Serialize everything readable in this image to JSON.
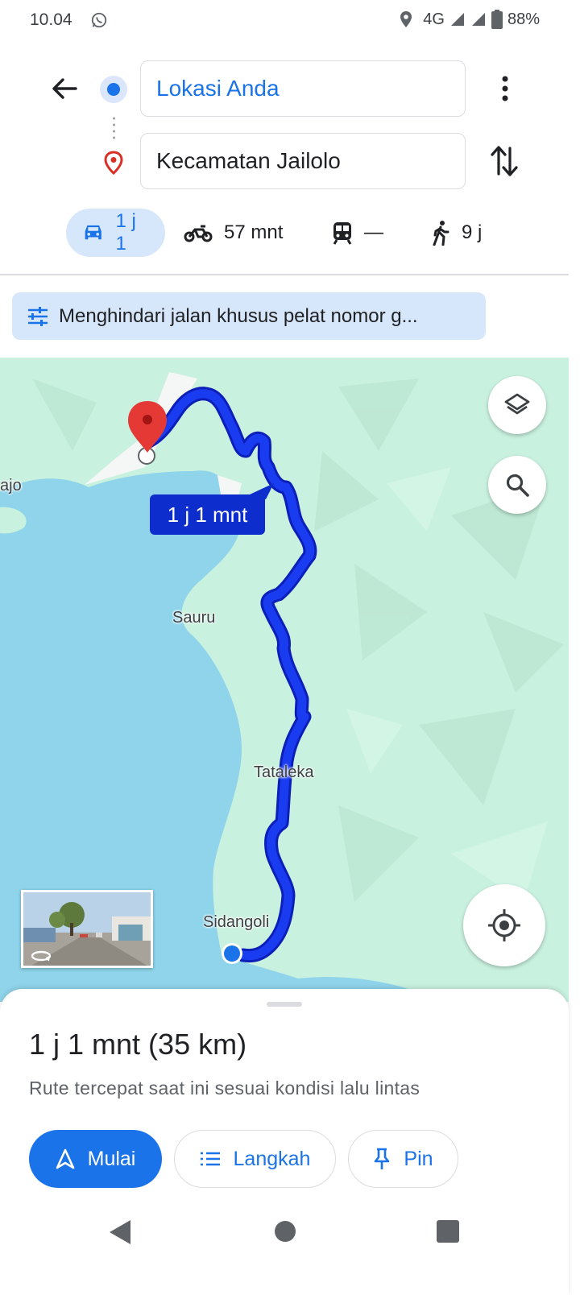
{
  "status_bar": {
    "time": "10.04",
    "network": "4G",
    "battery": "88%",
    "icons": [
      "whatsapp-icon",
      "location-icon",
      "signal-icon",
      "battery-icon"
    ]
  },
  "search": {
    "origin": "Lokasi Anda",
    "destination": "Kecamatan Jailolo"
  },
  "modes": [
    {
      "name": "car",
      "label": "1 j 1",
      "active": true
    },
    {
      "name": "motorcycle",
      "label": "57 mnt",
      "active": false
    },
    {
      "name": "transit",
      "label": "—",
      "active": false
    },
    {
      "name": "walk",
      "label": "9 j",
      "active": false
    }
  ],
  "chip": {
    "label": "Menghindari jalan khusus pelat nomor g..."
  },
  "map": {
    "eta_bubble": "1 j 1 mnt",
    "place_labels": {
      "ajo": "ajo",
      "sauru": "Sauru",
      "tataleka": "Tataleka",
      "sidangoli": "Sidangoli"
    },
    "colors": {
      "water": "#8fd4ea",
      "land": "#c9f1df",
      "route": "#1a3cf0",
      "route_casing": "#0c1fb8"
    }
  },
  "sheet": {
    "summary": "1 j 1 mnt (35 km)",
    "subtitle": "Rute tercepat saat ini sesuai kondisi lalu lintas",
    "start_label": "Mulai",
    "steps_label": "Langkah",
    "pin_label": "Pin"
  },
  "colors": {
    "accent": "#1a73e8",
    "chip_bg": "#d7e7fb"
  }
}
